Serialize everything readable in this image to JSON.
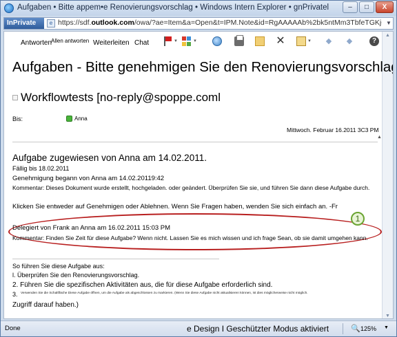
{
  "window": {
    "title": "Aufgaben • Bitte appem•e Renovierungsvorschlag • Windows Intern Explorer • gnPrivatel",
    "min_label": "–",
    "max_label": "□",
    "close_label": "X"
  },
  "address": {
    "inprivate_label": "InPrivate",
    "url_prefix": "https://sdf.",
    "url_domain": "outlook.com",
    "url_rest": "/owa/?ae=Item&a=Open&t=IPM.Note&id=RgAAAAAb%2bk5ntMm3TbfeTGKj6KZRBwDFtt1A/"
  },
  "toolbar": {
    "reply": "Antworten",
    "reply_all": "Allen antworten",
    "forward": "Weiterleiten",
    "chat": "Chat",
    "icons": [
      "flag-icon",
      "categories-icon",
      "globe-icon",
      "print-icon",
      "move-icon",
      "delete-icon",
      "clipboard-icon",
      "up-arrow-icon",
      "down-arrow-icon",
      "help-icon"
    ],
    "delete_glyph": "✕",
    "help_glyph": "?",
    "up_glyph": "◆",
    "down_glyph": "◆",
    "category_colors": [
      "#d6392b",
      "#3c8fd9",
      "#f0c33c",
      "#55a844"
    ]
  },
  "message": {
    "subject": "Aufgaben - Bitte genehmigen Sie den Renovierungsvorschlag",
    "sender": "Workflowtests [no-reply@spoppe.coml",
    "to_label": "Bis:",
    "to_name": "Anna",
    "date": "Mittwoch. Februar 16.2011 3C3 PM"
  },
  "body": {
    "heading": "Aufgabe zugewiesen von Anna am 14.02.2011.",
    "due": "Fällig bis 18.02.2011",
    "started": "Genehmigung begann von Anna am 14.02.20119:42",
    "comment1": "Kommentar: Dieses Dokument wurde erstellt, hochgeladen. oder geändert. Überprüfen Sie sie, und führen Sie dann diese Aufgabe durch.",
    "click_text": "Klicken Sie entweder auf Genehmigen oder Ablehnen. Wenn Sie Fragen haben, wenden Sie sich einfach an. -Fr",
    "delegated": "Delegiert von Frank an Anna am 16.02.2011 15:03 PM",
    "comment2": "Kommentar: Finden Sie Zeit für diese Aufgabe? Wenn nicht. Lassen Sie es mich wissen und ich frage Sean, ob sie damit umgehen kann.",
    "callout_number": "1",
    "howto": "So führen Sie diese Aufgabe aus:",
    "step1": "l. Überprüfen Sie den Renovierungsvorschlag.",
    "step2": "2. Führen Sie die spezifischen Aktivitäten aus, die für diese Aufgabe erforderlich sind.",
    "step3_number": "3.",
    "step3": "Verwenden Sie die Schaltfläche Diese Aufgabe öffnen, um die Aufgabe als abgeschlossen zu markieren. (Wenn Sie diese Aufgabe nicht aktualisieren können, ist dies möglicherweise nicht möglich.",
    "step3_end": "Zugriff darauf haben.)"
  },
  "status": {
    "done": "Done",
    "mode": "e Design I Geschützter Modus aktiviert",
    "zoom": "125%",
    "zoom_icon": "🔍",
    "dropdown": "▼"
  }
}
